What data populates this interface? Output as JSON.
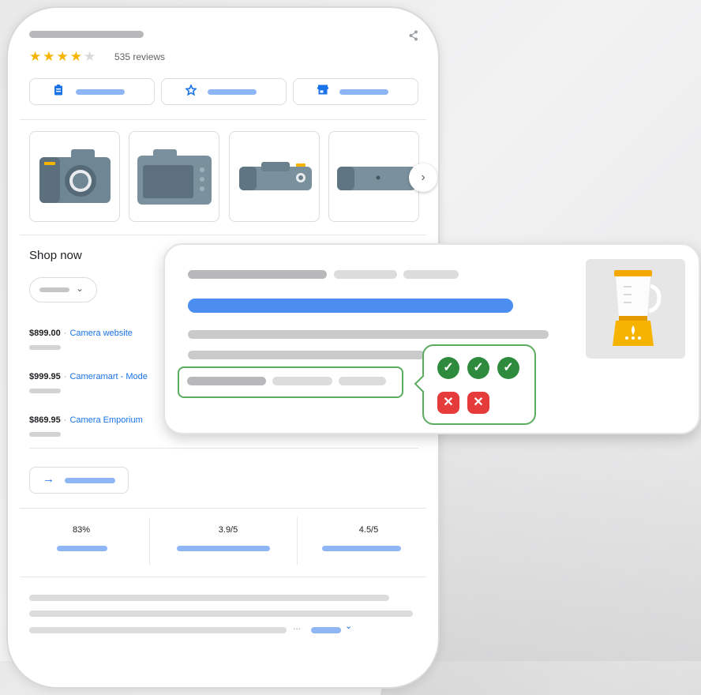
{
  "rating": {
    "stars": "★★★★",
    "star_off": "★",
    "value": 4,
    "max": 5,
    "reviews": "535 reviews"
  },
  "icons": {
    "share": "share-icon",
    "clipboard": "clipboard-icon",
    "star": "star-icon",
    "store": "store-icon",
    "chevron_right": "›",
    "chevron_down": "⌄",
    "arrow_right": "→",
    "check": "✓",
    "cross": "✕"
  },
  "shop": {
    "heading": "Shop now",
    "offers": [
      {
        "price": "$899.00",
        "sep": "·",
        "store": "Camera website"
      },
      {
        "price": "$999.95",
        "sep": "·",
        "store": "Cameramart - Mode"
      },
      {
        "price": "$869.95",
        "sep": "·",
        "store": "Camera Emporium"
      }
    ]
  },
  "stats": [
    {
      "value": "83%"
    },
    {
      "value": "3.9/5"
    },
    {
      "value": "4.5/5"
    }
  ],
  "description": {
    "ellipsis": "..."
  },
  "validation": {
    "passed": 3,
    "failed": 2
  },
  "colors": {
    "accent_blue": "#1a73e8",
    "star_yellow": "#f6b400",
    "check_green": "#2e8b3e",
    "error_red": "#e63b3b",
    "outline_green": "#5cab5f"
  }
}
